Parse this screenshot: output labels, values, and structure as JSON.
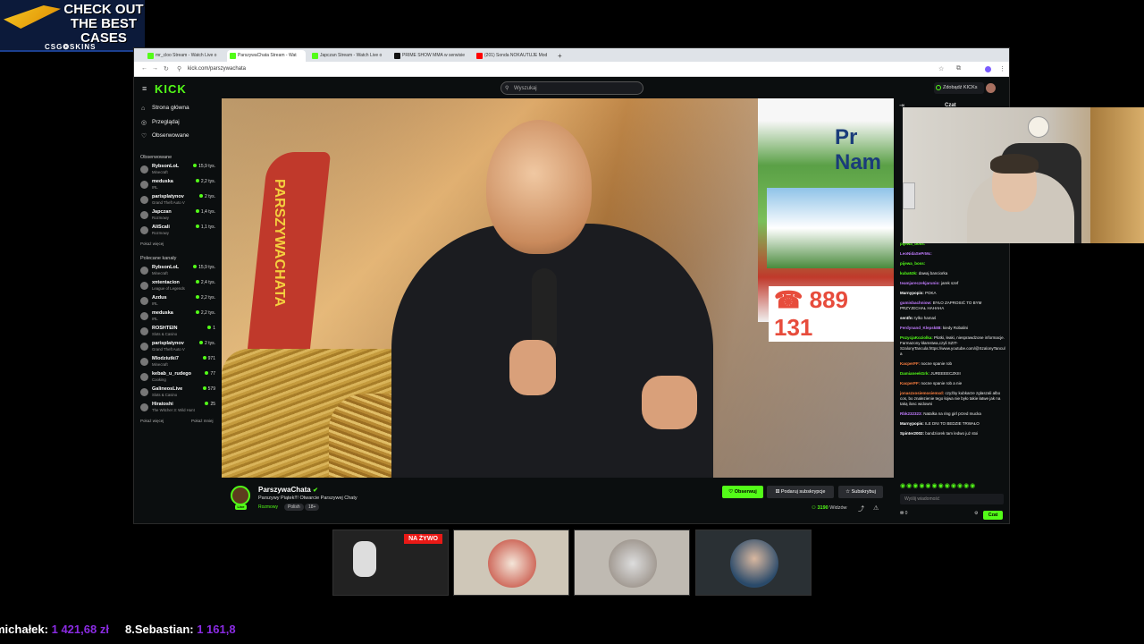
{
  "promo": {
    "text": "CHECK OUT THE BEST CASES",
    "brand": "CSG❂SKINS"
  },
  "tabs": [
    {
      "label": "mr_cloo Stream - Watch Live o",
      "color": "#53fc18"
    },
    {
      "label": "ParszywaChata Stream - Wat",
      "color": "#53fc18",
      "active": true
    },
    {
      "label": "Japczan Stream - Watch Live o",
      "color": "#53fc18"
    },
    {
      "label": "PRIME SHOW MMA w serwisie",
      "color": "#111111"
    },
    {
      "label": "(201) Sonda NOKAUTUJE Mod",
      "color": "#ff0000"
    }
  ],
  "url": "kick.com/parszywachata",
  "search_placeholder": "Wyszukaj",
  "get_kicks": "Zdobądź KICKs",
  "nav": {
    "home": "Strona główna",
    "browse": "Przeglądaj",
    "following": "Obserwowane"
  },
  "following_title": "Obserwowane",
  "following": [
    {
      "name": "RybsonLoL",
      "game": "Minecraft",
      "viewers": "15,9 tys."
    },
    {
      "name": "meduska",
      "game": "IRL",
      "viewers": "2,2 tys."
    },
    {
      "name": "parisplatynov",
      "game": "Grand Theft Auto V",
      "viewers": "2 tys."
    },
    {
      "name": "Japczan",
      "game": "Rozmowy",
      "viewers": "1,4 tys."
    },
    {
      "name": "AliScali",
      "game": "Rozmowy",
      "viewers": "1,1 tys."
    }
  ],
  "show_more": "Pokaż więcej",
  "recommended_title": "Polecane kanały",
  "recommended": [
    {
      "name": "RybsonLoL",
      "game": "Minecraft",
      "viewers": "15,9 tys."
    },
    {
      "name": "xntentacion",
      "game": "League of Legends",
      "viewers": "2,4 tys."
    },
    {
      "name": "Azdus",
      "game": "IRL",
      "viewers": "2,2 tys."
    },
    {
      "name": "meduska",
      "game": "IRL",
      "viewers": "2,2 tys."
    },
    {
      "name": "ROSHTEIN",
      "game": "Slots & Casino",
      "viewers": "1"
    },
    {
      "name": "parisplatynov",
      "game": "Grand Theft Auto V",
      "viewers": "2 tys."
    },
    {
      "name": "Mlodziutki7",
      "game": "Minecraft",
      "viewers": "971"
    },
    {
      "name": "kebab_u_rudego",
      "game": "Cooking",
      "viewers": "77"
    },
    {
      "name": "GalineosLive",
      "game": "Slots & Casino",
      "viewers": "579"
    },
    {
      "name": "Hiratoshi",
      "game": "The Witcher 3: Wild Hunt",
      "viewers": "25"
    }
  ],
  "show_less": "Pokaż mniej",
  "video": {
    "flag_text": "PARSZYWACHATA",
    "banner_text": "Pr Nam",
    "phone": "889 131"
  },
  "stream": {
    "name": "ParszywaChata",
    "title": "Parszywy Piątek!!! Otwarcie Parszywej Chaty",
    "category": "Rozmowy",
    "tags": [
      "Polish",
      "18+"
    ],
    "live": "Live",
    "viewers": "3190",
    "viewers_label": "Widzów"
  },
  "buttons": {
    "follow": "Obserwuj",
    "gift": "Podaruj subskrypcje",
    "subscribe": "Subskrybuj"
  },
  "chat": {
    "title": "Czat",
    "messages": [
      {
        "user": "pijewa_boss:",
        "text": "",
        "color": "#53fc18"
      },
      {
        "user": "LeoNidaSePrMc:",
        "text": "",
        "color": "#c27cff"
      },
      {
        "user": "pijewa_boss:",
        "text": "",
        "color": "#53fc18"
      },
      {
        "user": "kuba53k:",
        "text": "dawaj banciorka",
        "color": "#53fc18"
      },
      {
        "user": "teamjareczekjarunio:",
        "text": "jarek szef",
        "color": "#c27cff"
      },
      {
        "user": "Marnypopis:",
        "text": "POKA",
        "color": "#ffffff"
      },
      {
        "user": "gumisbachniow:",
        "text": "BYŁO ZAPROSIĆ TO BYM PRZYJECHAŁ HAHAHA",
        "color": "#c27cff"
      },
      {
        "user": "ser4fn:",
        "text": "tylko hamaś",
        "color": "#ffffff"
      },
      {
        "user": "Ferdynand_Klepsk88:",
        "text": "kiedy Robalini",
        "color": "#c27cff"
      },
      {
        "user": "PozycjaKoziolka:",
        "text": "Plotki, leaki, niesprawdzone informacje. Farmazony kłamstwa,czyli SZIT-SzalonyTancula:https://www.youtube.com/@SzalonyTancula",
        "color": "#53fc18"
      },
      {
        "user": "KacperFF:",
        "text": "nocne spanie rob",
        "color": "#ff8040"
      },
      {
        "user": "DamianeekGrk:",
        "text": "JUREEEECZKIII",
        "color": "#53fc18"
      },
      {
        "user": "KacperFF:",
        "text": "nocne spanie rob a nie",
        "color": "#ff8040"
      },
      {
        "user": "jonaszxosiemosiemxd:",
        "text": "czyżby kubkarze zgłaszali albo cos, bo znalezienie tego łojwa nie było takie łatwe jak na taką ilosc widowni",
        "color": "#ff8040"
      },
      {
        "user": "Rbk232323:",
        "text": "Natalka na ring girl przed mucka",
        "color": "#c27cff"
      },
      {
        "user": "Marnypopis:",
        "text": "ILE DNI TO BEDZIE TRWAŁO",
        "color": "#ffffff"
      },
      {
        "user": "Spinter2002:",
        "text": "bandziorek tam ledwo już stoi",
        "color": "#ffffff"
      }
    ],
    "input_placeholder": "Wyślij wiadomość",
    "send": "Czat",
    "points": "0",
    "count": "0"
  },
  "live_badge": "NA ŻYWO",
  "ticker": [
    {
      "name": "michałek:",
      "amount": "1 421,68 zł"
    },
    {
      "name": "8.Sebastian:",
      "amount": "1 161,8"
    }
  ]
}
